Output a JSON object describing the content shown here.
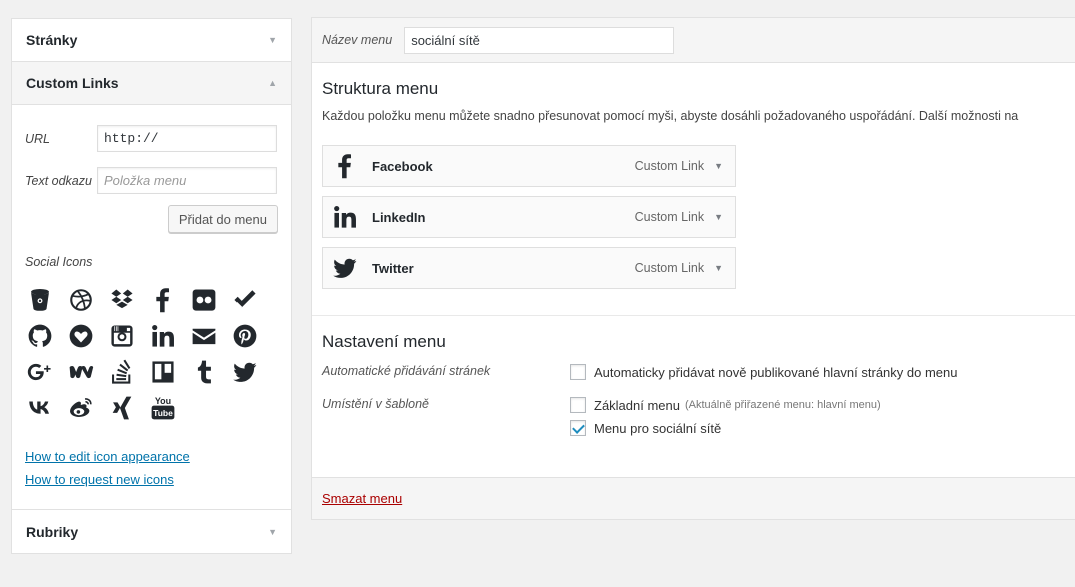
{
  "sidebar": {
    "pages_label": "Stránky",
    "custom_links_label": "Custom Links",
    "url_label": "URL",
    "url_value": "http://",
    "link_text_label": "Text odkazu",
    "link_text_placeholder": "Položka menu",
    "add_button": "Přidat do menu",
    "social_icons_label": "Social Icons",
    "social_icons": [
      "bitbucket-icon",
      "dribbble-icon",
      "dropbox-icon",
      "facebook-icon",
      "flickr-icon",
      "foursquare-icon",
      "github-icon",
      "gittip-icon",
      "instagram-icon",
      "linkedin-icon",
      "email-icon",
      "pinterest-icon",
      "googleplus-icon",
      "path-icon",
      "stackoverflow-icon",
      "trello-icon",
      "tumblr-icon",
      "twitter-icon",
      "vk-icon",
      "weibo-icon",
      "xing-icon",
      "youtube-icon"
    ],
    "help_links": [
      "How to edit icon appearance",
      "How to request new icons"
    ],
    "categories_label": "Rubriky"
  },
  "menu": {
    "name_label": "Název menu",
    "name_value": "sociální sítě",
    "structure_title": "Struktura menu",
    "structure_desc": "Každou položku menu můžete snadno přesunovat pomocí myši, abyste dosáhli požadovaného uspořádání. Další možnosti na",
    "items": [
      {
        "title": "Facebook",
        "type": "Custom Link",
        "icon": "facebook-icon"
      },
      {
        "title": "LinkedIn",
        "type": "Custom Link",
        "icon": "linkedin-icon"
      },
      {
        "title": "Twitter",
        "type": "Custom Link",
        "icon": "twitter-icon"
      }
    ],
    "settings_title": "Nastavení menu",
    "auto_add_label": "Automatické přidávání stránek",
    "auto_add_text": "Automaticky přidávat nově publikované hlavní stránky do menu",
    "auto_add_checked": false,
    "location_label": "Umístění v šabloně",
    "location_primary": "Základní menu",
    "location_primary_note": "(Aktuálně přiřazené menu: hlavní menu)",
    "location_primary_checked": false,
    "location_social": "Menu pro sociální sítě",
    "location_social_checked": true,
    "delete_link": "Smazat menu"
  },
  "colors": {
    "link": "#0073aa",
    "delete": "#aa0000",
    "icon": "#23282d"
  }
}
